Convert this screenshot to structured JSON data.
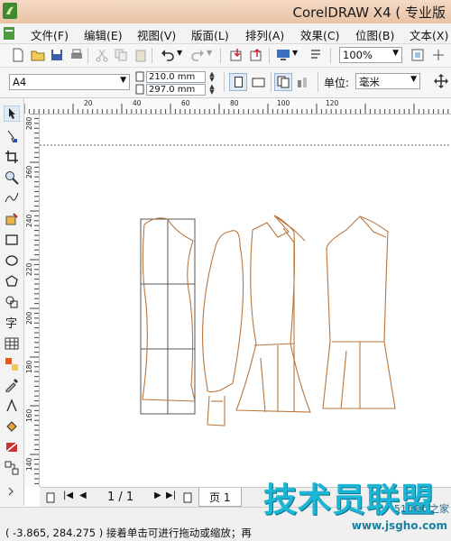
{
  "title": "CorelDRAW X4 ( 专业版",
  "menu": [
    "文件(F)",
    "编辑(E)",
    "视图(V)",
    "版面(L)",
    "排列(A)",
    "效果(C)",
    "位图(B)",
    "文本(X)"
  ],
  "toolbar": {
    "zoom": "100%"
  },
  "property_bar": {
    "paper_size": "A4",
    "width": "210.0 mm",
    "height": "297.0 mm",
    "unit_label": "单位:",
    "unit_value": "毫米"
  },
  "rulers": {
    "horizontal": [
      "20",
      "40",
      "60",
      "80",
      "100",
      "120"
    ],
    "vertical": [
      "280",
      "260",
      "240",
      "220",
      "200",
      "180",
      "160",
      "140"
    ]
  },
  "page_nav": {
    "counter": "1 / 1",
    "tab": "页 1"
  },
  "status": {
    "coords": "( -3.865, 284.275 )",
    "message": "接着单击可进行拖动或缩放；再"
  },
  "watermark": {
    "brand": "技术员联盟",
    "url": "www.jsgho.com",
    "corner": "51.net 之家"
  }
}
